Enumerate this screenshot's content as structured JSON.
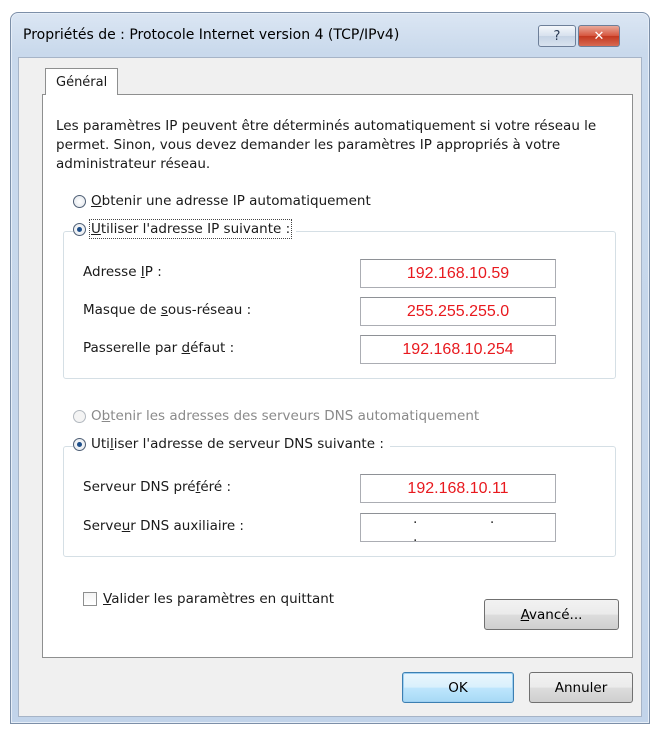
{
  "window": {
    "title": "Propriétés de : Protocole Internet version 4 (TCP/IPv4)",
    "help_label": "?",
    "close_label": "✕"
  },
  "tabs": [
    {
      "label": "Général",
      "selected": true
    }
  ],
  "intro_text": "Les paramètres IP peuvent être déterminés automatiquement si votre réseau le permet. Sinon, vous devez demander les paramètres IP appropriés à votre administrateur réseau.",
  "ip_section": {
    "auto_option": {
      "prefix": "",
      "accel": "O",
      "rest": "btenir une adresse IP automatiquement",
      "checked": false
    },
    "manual_option": {
      "prefix": "",
      "accel": "U",
      "rest": "tiliser l'adresse IP suivante :",
      "checked": true
    },
    "fields": [
      {
        "label_pre": "Adresse ",
        "accel": "I",
        "label_post": "P :",
        "value": "192.168.10.59"
      },
      {
        "label_pre": "Masque de ",
        "accel": "s",
        "label_post": "ous-réseau :",
        "value": "255.255.255.0"
      },
      {
        "label_pre": "Passerelle par ",
        "accel": "d",
        "label_post": "éfaut :",
        "value": "192.168.10.254"
      }
    ]
  },
  "dns_section": {
    "auto_option": {
      "prefix": "O",
      "accel": "b",
      "rest": "tenir les adresses des serveurs DNS automatiquement",
      "checked": false,
      "disabled": true
    },
    "manual_option": {
      "prefix": "Uti",
      "accel": "l",
      "rest": "iser l'adresse de serveur DNS suivante :",
      "checked": true
    },
    "fields": [
      {
        "label_pre": "Serveur DNS pré",
        "accel": "f",
        "label_post": "éré :",
        "value": "192.168.10.11"
      },
      {
        "label_pre": "Serve",
        "accel": "u",
        "label_post": "r DNS auxiliaire :",
        "value": ". . ."
      }
    ]
  },
  "validate_checkbox": {
    "accel": "V",
    "rest": "alider les paramètres en quittant",
    "checked": false
  },
  "buttons": {
    "advanced": {
      "accel": "A",
      "rest": "vancé..."
    },
    "ok": "OK",
    "cancel": "Annuler"
  },
  "colors": {
    "ip_value_text": "#e8191e",
    "title_gradient_top": "#dbe6f3",
    "close_button": "#c3381f"
  }
}
